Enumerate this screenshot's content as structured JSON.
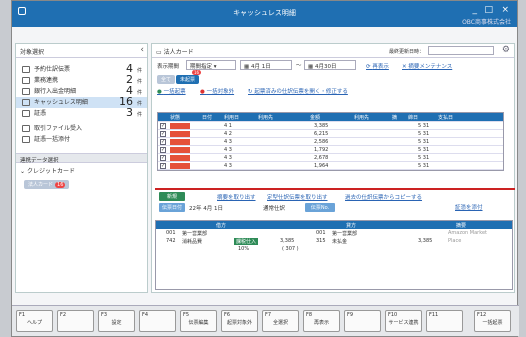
{
  "window": {
    "title": "キャッシュレス明細",
    "company": "OBC商事株式会社",
    "icon": "app-icon",
    "controls": [
      "_",
      "□",
      "×"
    ]
  },
  "sidebar": {
    "header": "対象選択",
    "items": [
      {
        "label": "予約仕訳伝票",
        "count": "4",
        "unit": "件",
        "icon": "calendar-icon"
      },
      {
        "label": "業務連携",
        "count": "2",
        "unit": "件",
        "icon": "link-icon"
      },
      {
        "label": "銀行入出金明細",
        "count": "4",
        "unit": "件",
        "icon": "bank-icon"
      },
      {
        "label": "キャッシュレス明細",
        "count": "16",
        "unit": "件",
        "icon": "card-icon"
      },
      {
        "label": "証憑",
        "count": "3",
        "unit": "件",
        "icon": "doc-icon"
      },
      {
        "label": "取引ファイル受入",
        "count": "",
        "unit": "",
        "icon": "file-icon"
      },
      {
        "label": "証憑一括添付",
        "count": "",
        "unit": "",
        "icon": "clip-icon"
      }
    ],
    "section": "連携データ選択",
    "tree_label": "クレジットカード",
    "chip_label": "法人カード",
    "chip_count": "16"
  },
  "main": {
    "title": "法人カード",
    "update_label": "最終更新日時：",
    "period_label": "表示期間",
    "period_select": "期間指定",
    "date_from": "4月 1日",
    "date_to": "4月30日",
    "refresh": "再表示",
    "master": "摘要メンテナンス",
    "tabs": [
      "全て",
      "未起票"
    ],
    "tab_badge": "16",
    "actions": [
      "一括起票",
      "一括対象外",
      "起票済みの仕訳伝票を開く・修正する"
    ],
    "grid_headers": [
      "状態",
      "日付",
      "利用日",
      "利用先",
      "金額",
      "利用先",
      "摘",
      "締日",
      "支払日"
    ],
    "rows": [
      {
        "date": "4 1",
        "amount": "3,385",
        "pay": "5 31",
        "checked": true
      },
      {
        "date": "4 2",
        "amount": "6,215",
        "pay": "5 31",
        "checked": true
      },
      {
        "date": "4 3",
        "amount": "2,586",
        "pay": "5 31",
        "checked": true
      },
      {
        "date": "4 3",
        "amount": "1,792",
        "pay": "5 31",
        "checked": true
      },
      {
        "date": "4 3",
        "amount": "2,678",
        "pay": "5 31",
        "checked": true
      },
      {
        "date": "4 3",
        "amount": "1,964",
        "pay": "5 31",
        "checked": true
      }
    ]
  },
  "lower": {
    "new_btn": "新規",
    "date_btn": "伝票日付",
    "date_val": "22年 4月 1日",
    "kind": "通常仕訳",
    "slip_btn": "伝票No.",
    "links": [
      "摘要を取り出す",
      "定型仕訳伝票を取り出す",
      "過去の仕訳伝票からコピーする"
    ],
    "attach": "証憑を添付",
    "heads": [
      "借方",
      "貸方",
      "摘要"
    ],
    "rows": [
      [
        "001",
        "第一営業部",
        "",
        "001",
        "第一営業部",
        "",
        ""
      ],
      [
        "742",
        "消耗品費",
        "",
        "315",
        "未払金",
        "3,385",
        "Place"
      ],
      [
        "",
        "",
        "10%",
        "",
        "",
        "",
        ""
      ]
    ],
    "debit_amt": "3,385",
    "tax_badge": "課税仕入",
    "tax_amt": "( 307 )",
    "memo": "Amazon Market"
  },
  "fkeys": [
    {
      "k": "F1",
      "l": "ヘルプ"
    },
    {
      "k": "F2",
      "l": ""
    },
    {
      "k": "F3",
      "l": "設定"
    },
    {
      "k": "F4",
      "l": ""
    },
    {
      "k": "F5",
      "l": "伝票編集"
    },
    {
      "k": "F6",
      "l": "起票対象外"
    },
    {
      "k": "F7",
      "l": "全選択"
    },
    {
      "k": "F8",
      "l": "再表示"
    },
    {
      "k": "F9",
      "l": ""
    },
    {
      "k": "F10",
      "l": "サービス連携"
    },
    {
      "k": "F11",
      "l": ""
    },
    {
      "k": "F12",
      "l": "一括起票"
    }
  ]
}
